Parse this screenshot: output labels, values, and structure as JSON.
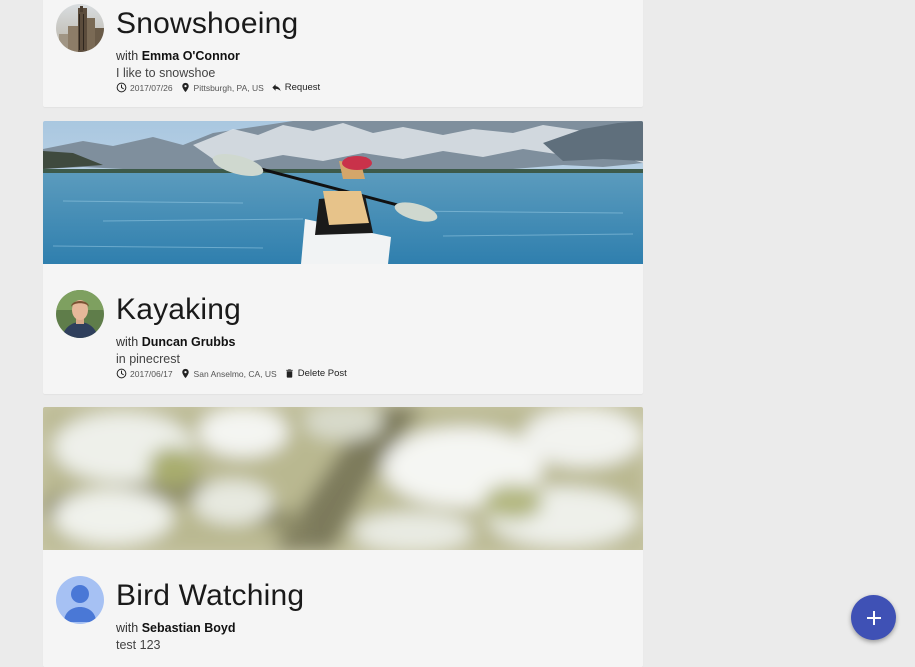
{
  "feed": {
    "events": [
      {
        "title": "Snowshoeing",
        "with_prefix": "with",
        "host": "Emma O'Connor",
        "description": "I like to snowshoe",
        "date": "2017/07/26",
        "location": "Pittsburgh, PA, US",
        "action_label": "Request",
        "action_icon": "reply-icon",
        "avatar": "city-skyline-photo"
      },
      {
        "title": "Kayaking",
        "with_prefix": "with",
        "host": "Duncan Grubbs",
        "description": "in pinecrest",
        "date": "2017/06/17",
        "location": "San Anselmo, CA, US",
        "action_label": "Delete Post",
        "action_icon": "trash-icon",
        "avatar": "person-photo",
        "cover_image": "kayaker-on-mountain-lake"
      },
      {
        "title": "Bird Watching",
        "with_prefix": "with",
        "host": "Sebastian Boyd",
        "description": "test 123",
        "avatar": "default-user-placeholder",
        "cover_image": "blurred-white-blossoms"
      }
    ]
  },
  "fab": {
    "icon": "plus-icon"
  },
  "colors": {
    "page_background": "#ebebeb",
    "card_background": "#f5f5f5",
    "fab": "#3f51b5",
    "placeholder_avatar_bg": "#a6c1f3",
    "placeholder_avatar_fg": "#4a78d6"
  }
}
